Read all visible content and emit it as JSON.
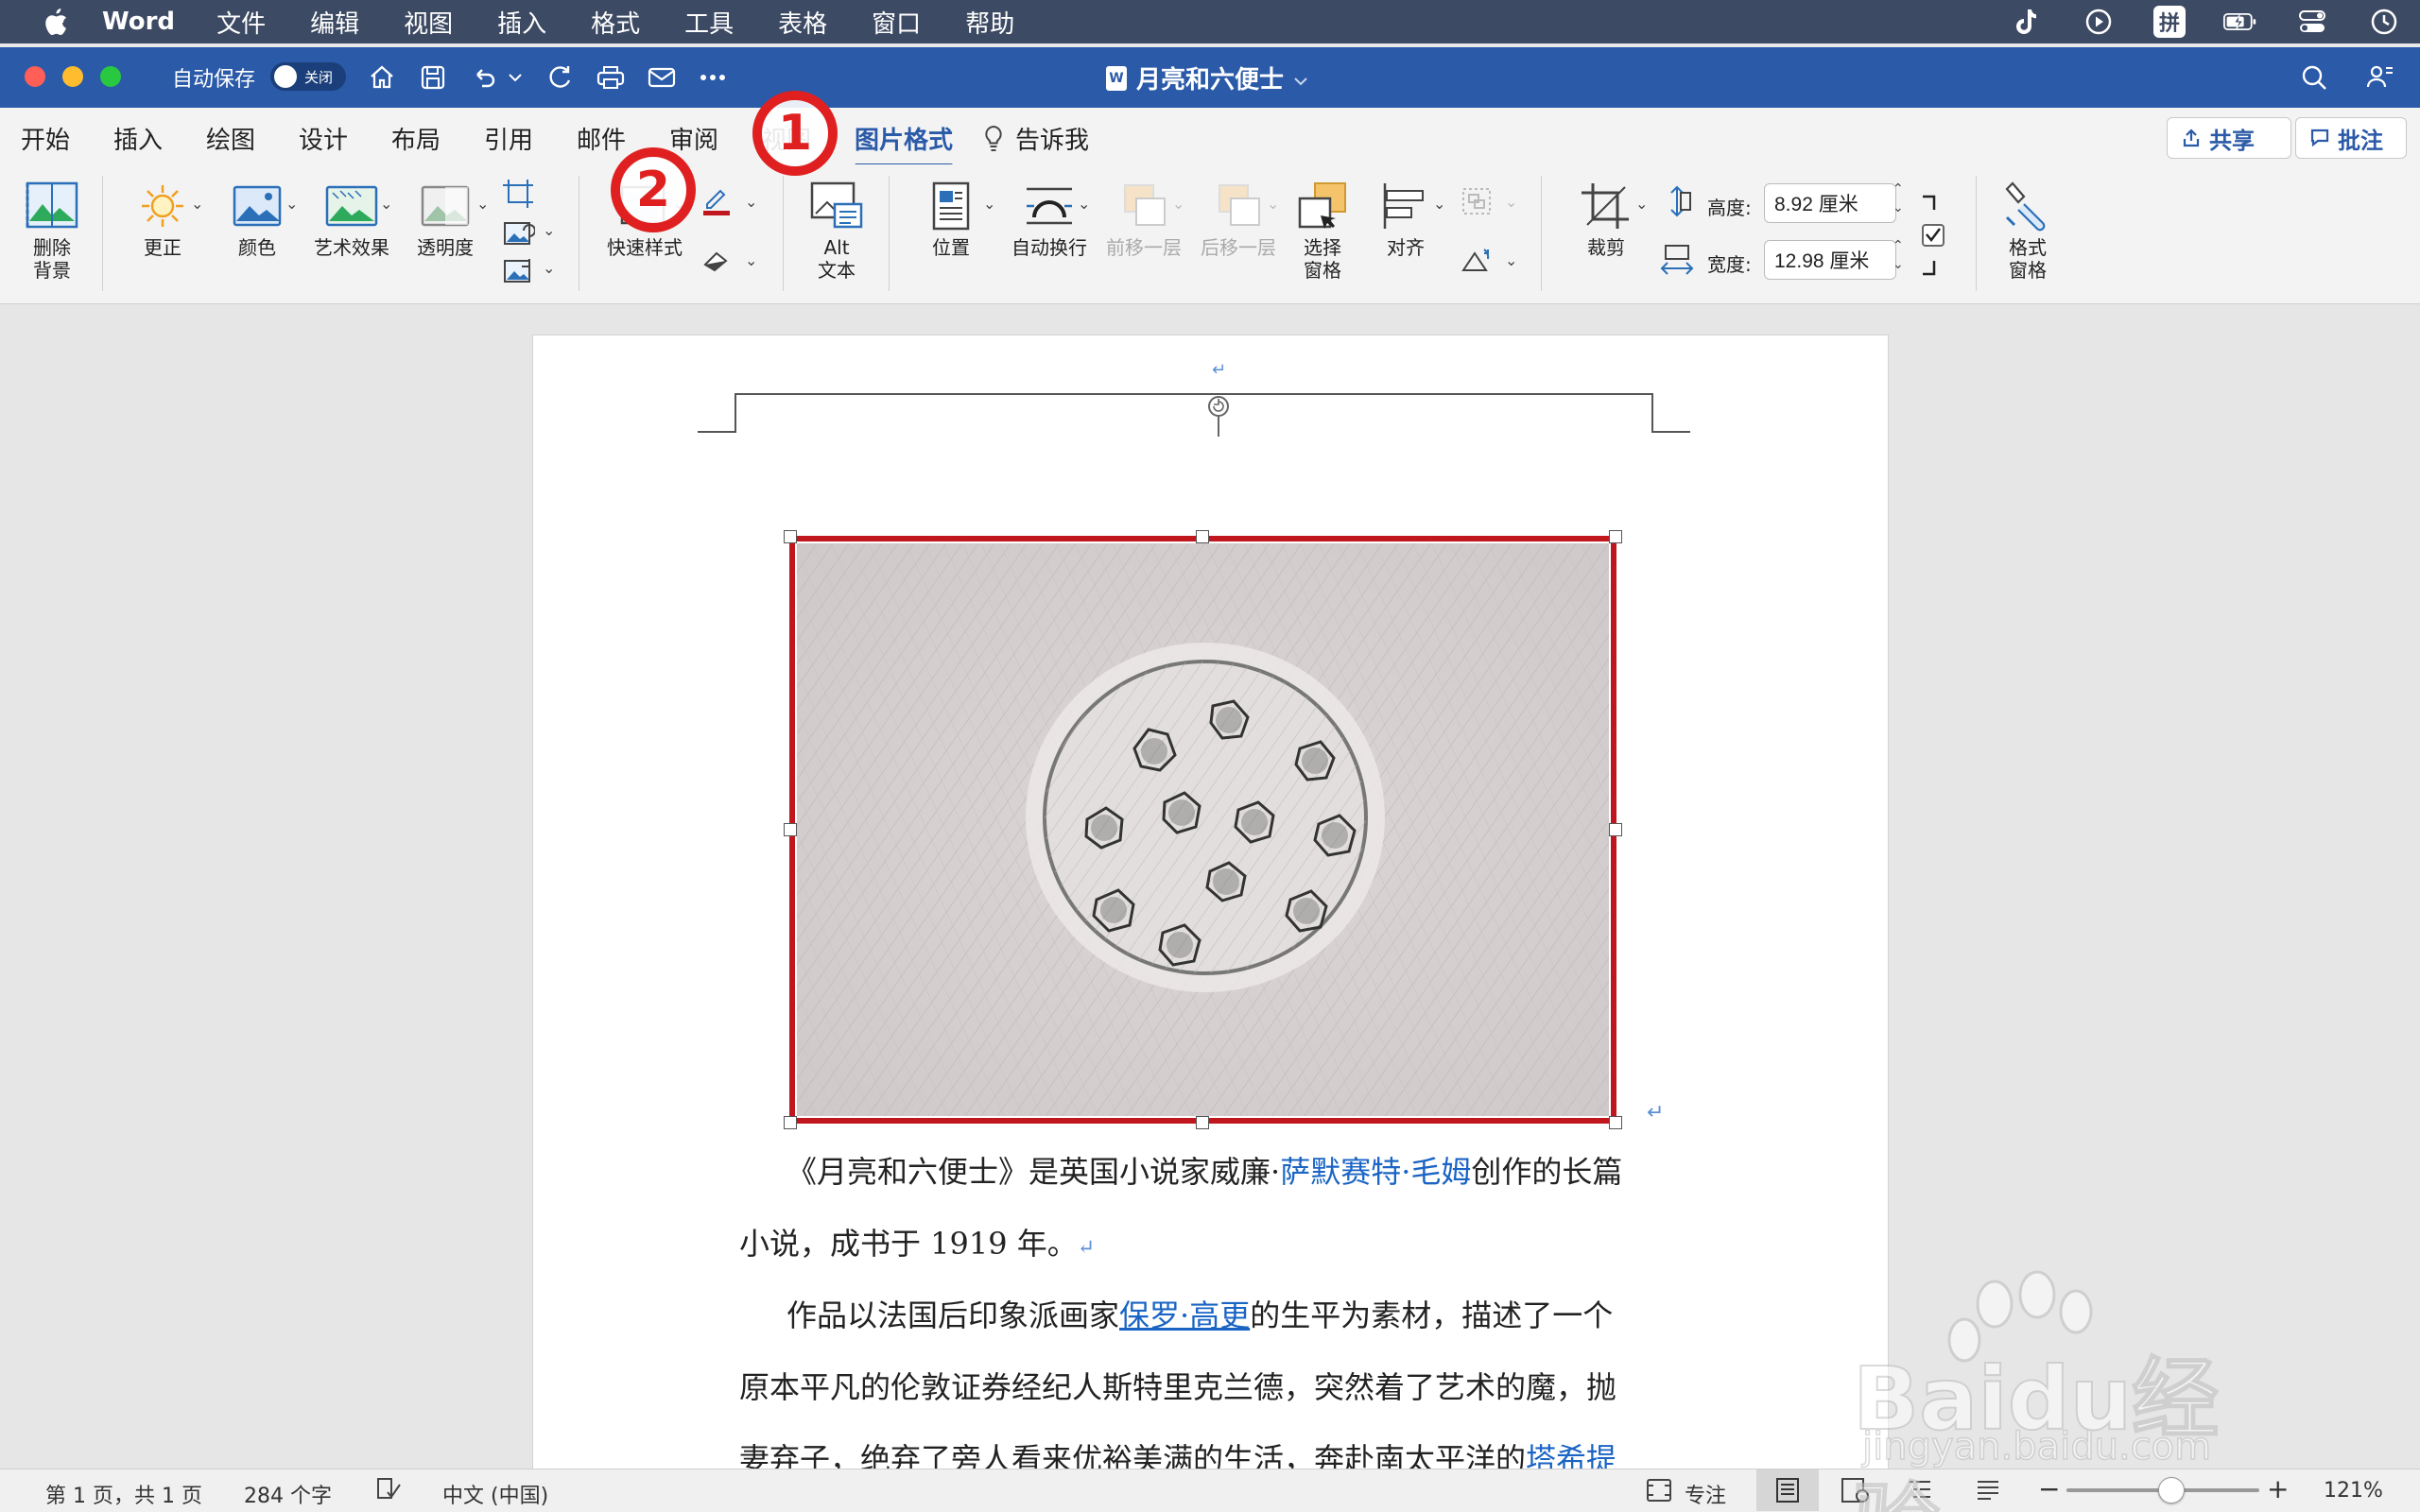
{
  "menubar": {
    "app_name": "Word",
    "items": [
      "文件",
      "编辑",
      "视图",
      "插入",
      "格式",
      "工具",
      "表格",
      "窗口",
      "帮助"
    ],
    "status_icons": [
      "tiktok-icon",
      "play-icon",
      "input-method-icon",
      "battery-icon",
      "control-center-icon",
      "clock-icon"
    ],
    "input_method_label": "拼"
  },
  "titlebar": {
    "autosave_label": "自动保存",
    "autosave_state": "关闭",
    "doc_title": "月亮和六便士",
    "doc_icon_label": "W"
  },
  "tabs": {
    "items": [
      "开始",
      "插入",
      "绘图",
      "设计",
      "布局",
      "引用",
      "邮件",
      "审阅",
      "视图",
      "图片格式",
      "告诉我"
    ],
    "active": "图片格式",
    "share_label": "共享",
    "comments_label": "批注"
  },
  "ribbon": {
    "remove_bg": "删除\n背景",
    "corrections": "更正",
    "color": "颜色",
    "artistic_effects": "艺术效果",
    "transparency": "透明度",
    "quick_styles": "快速样式",
    "alt_text": "Alt\n文本",
    "position": "位置",
    "wrap_text": "自动换行",
    "bring_forward": "前移一层",
    "send_backward": "后移一层",
    "selection_pane": "选择\n窗格",
    "align": "对齐",
    "crop": "裁剪",
    "height_label": "高度:",
    "height_value": "8.92 厘米",
    "width_label": "宽度:",
    "width_value": "12.98 厘米",
    "format_pane": "格式\n窗格"
  },
  "document": {
    "para1_line1_pre": "《月亮和六便士》是英国小说家威廉·",
    "para1_link": "萨默赛特·毛姆",
    "para1_line1_post": "创作的长篇",
    "para1_line2": "小说，成书于 1919 年。",
    "para2_line1_pre": "作品以法国后印象派画家",
    "para2_link": "保罗·高更",
    "para2_line1_post": "的生平为素材，描述了一个",
    "para2_line2": "原本平凡的伦敦证券经纪人斯特里克兰德，突然着了艺术的魔，抛",
    "para2_line3_pre": "妻弃子，绝弃了旁人看来优裕美满的生活，奔赴南太平洋的",
    "para2_line3_link": "塔希提",
    "return_mark": "↵"
  },
  "statusbar": {
    "page": "第 1 页，共 1 页",
    "words": "284 个字",
    "language": "中文 (中国)",
    "focus": "专注",
    "zoom": "121%",
    "zoom_level": 0.55
  },
  "annotations": {
    "one": "1",
    "two": "2"
  },
  "watermark": {
    "brand": "Baidu经验",
    "url": "jingyan.baidu.com"
  },
  "colors": {
    "menubar": "#3d4a63",
    "titlebar": "#2b5aa8",
    "selection_border": "#c0171f",
    "annotation": "#e02020",
    "link": "#1a64c4"
  }
}
